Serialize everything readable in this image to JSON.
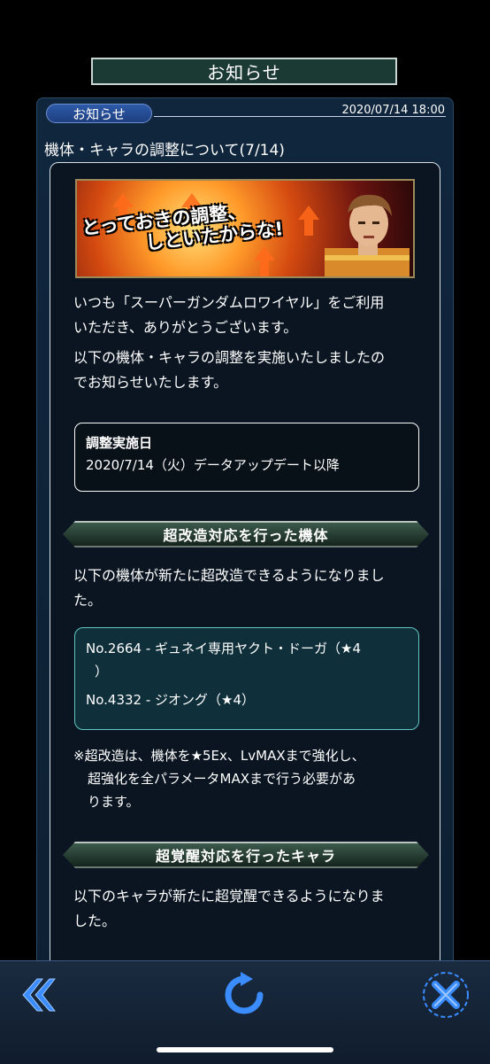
{
  "header": {
    "title": "お知らせ"
  },
  "notice": {
    "category": "お知らせ",
    "datetime": "2020/07/14 18:00",
    "headline": "機体・キャラの調整について(7/14)"
  },
  "banner": {
    "line1": "とっておきの調整、",
    "line2": "しといたからな!"
  },
  "body": {
    "intro_line1": "いつも「スーパーガンダムロワイヤル」をご利用",
    "intro_line2": "いただき、ありがとうございます。",
    "intro2_line1": "以下の機体・キャラの調整を実施いたしましたの",
    "intro2_line2": "でお知らせいたします。"
  },
  "schedule": {
    "label": "調整実施日",
    "value": "2020/7/14（火）データアップデート以降"
  },
  "section1": {
    "title": "超改造対応を行った機体",
    "desc_line1": "以下の機体が新たに超改造できるようになりまし",
    "desc_line2": "た。",
    "items": [
      "No.2664 - ギュネイ専用ヤクト・ドーガ（★4",
      "）",
      "No.4332 - ジオング（★4）"
    ],
    "note_line1": "※超改造は、機体を★5Ex、LvMAXまで強化し、",
    "note_line2": "超強化を全パラメータMAXまで行う必要があ",
    "note_line3": "ります。"
  },
  "section2": {
    "title": "超覚醒対応を行ったキャラ",
    "desc_line1": "以下のキャラが新たに超覚醒できるようになりま",
    "desc_line2": "した。"
  },
  "nav": {
    "back_icon": "double-chevron-left-icon",
    "reload_icon": "reload-icon",
    "close_icon": "close-icon"
  },
  "colors": {
    "accent_blue": "#2f7fff",
    "section_green": "#3c5a4c",
    "list_border": "#62c7c2"
  }
}
